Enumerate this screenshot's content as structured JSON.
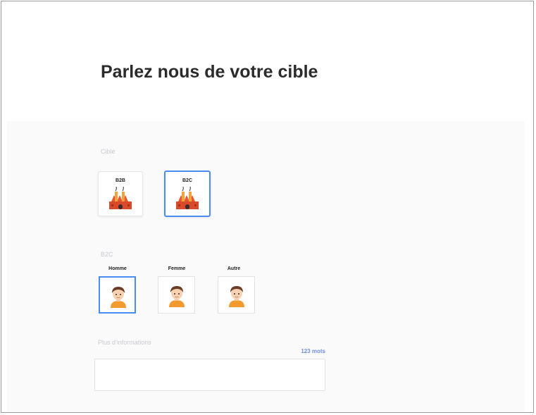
{
  "page_title": "Parlez nous de votre cible",
  "cible": {
    "label": "Cible",
    "options": [
      {
        "label": "B2B",
        "icon": "factory-icon",
        "selected": false
      },
      {
        "label": "B2C",
        "icon": "factory-icon",
        "selected": true
      }
    ]
  },
  "b2c": {
    "label": "B2C",
    "genders": [
      {
        "label": "Homme",
        "icon": "person-avatar-icon",
        "selected": true
      },
      {
        "label": "Femme",
        "icon": "person-avatar-icon",
        "selected": false
      },
      {
        "label": "Autre",
        "icon": "person-avatar-icon",
        "selected": false
      }
    ]
  },
  "more_info": {
    "label": "Plus d'informations",
    "word_count": "123 mots",
    "value": ""
  },
  "colors": {
    "accent": "#4a8df2",
    "word_count": "#6f8ef0",
    "muted_label": "#c9c9d2",
    "factory_red": "#d94a2b",
    "factory_orange": "#f2a23a"
  }
}
